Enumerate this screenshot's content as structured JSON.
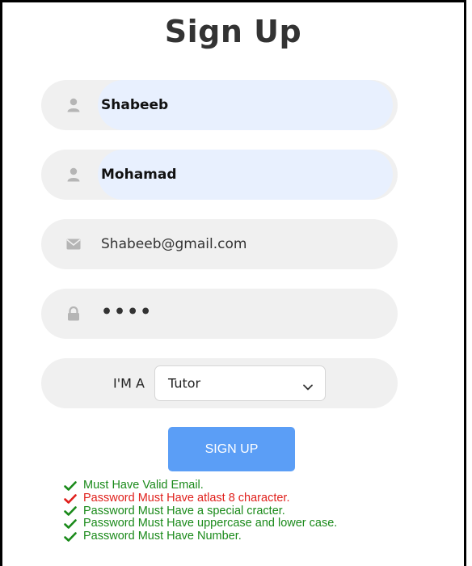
{
  "form": {
    "title": "Sign Up",
    "first_name": {
      "value": "Shabeeb",
      "icon": "user-icon"
    },
    "last_name": {
      "value": "Mohamad",
      "icon": "user-icon"
    },
    "email": {
      "value": "Shabeeb@gmail.com",
      "icon": "envelope-icon"
    },
    "password": {
      "value": "••••",
      "icon": "lock-icon"
    },
    "role": {
      "label": "I'M A",
      "selected": "Tutor"
    },
    "submit_label": "SIGN UP"
  },
  "validation": [
    {
      "text": "Must Have Valid Email.",
      "status": "pass"
    },
    {
      "text": "Password Must Have atlast 8 character.",
      "status": "fail"
    },
    {
      "text": "Password Must Have a special cracter.",
      "status": "pass"
    },
    {
      "text": "Password Must Have uppercase and lower case.",
      "status": "pass"
    },
    {
      "text": "Password Must Have Number.",
      "status": "pass"
    }
  ],
  "colors": {
    "field_bg": "#f0f0f0",
    "autofill_bg": "#e8f0fe",
    "button_bg": "#5b9ef6",
    "pass": "#1a8a1a",
    "fail": "#e0201c"
  }
}
